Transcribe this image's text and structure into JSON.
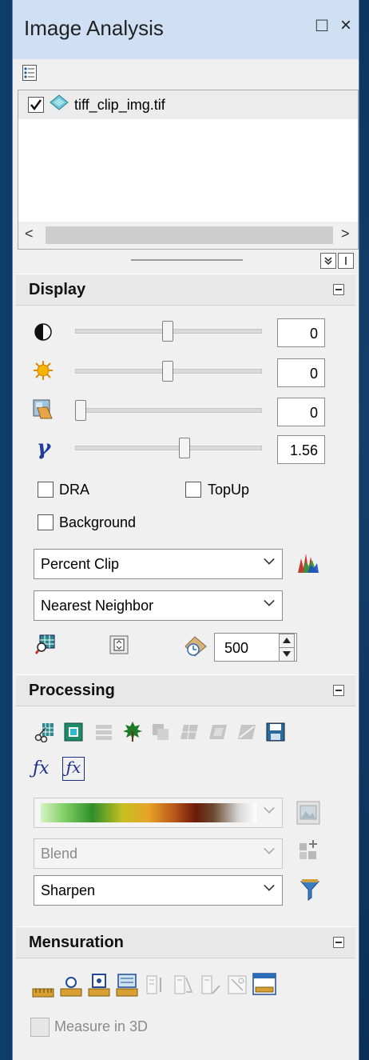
{
  "window": {
    "title": "Image Analysis",
    "maximize_glyph": "□",
    "close_glyph": "×"
  },
  "layers": [
    {
      "name": "tiff_clip_img.tif",
      "checked": true
    }
  ],
  "display": {
    "header": "Display",
    "contrast_value": "0",
    "brightness_value": "0",
    "transparency_value": "0",
    "gamma_value": "1.56",
    "dra_label": "DRA",
    "topup_label": "TopUp",
    "background_label": "Background",
    "stretch_select": "Percent Clip",
    "resample_select": "Nearest Neighbor",
    "refresh_value": "500"
  },
  "processing": {
    "header": "Processing",
    "blend_select": "Blend",
    "sharpen_select": "Sharpen"
  },
  "mensuration": {
    "header": "Mensuration",
    "measure3d_label": "Measure in 3D"
  },
  "icons": {
    "gamma": "γ",
    "scroll_left": "<",
    "scroll_right": ">"
  }
}
